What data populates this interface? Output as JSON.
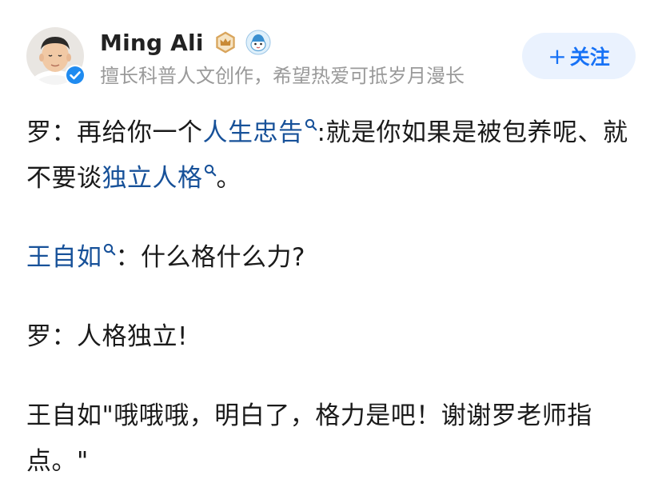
{
  "author": {
    "name": "Ming Ali",
    "bio": "擅长科普人文创作，希望热爱可抵岁月漫长",
    "avatar_icon": "avatar-photo",
    "verified_icon": "verified-check-icon",
    "level_badge_icon": "crown-level-icon",
    "fan_badge_icon": "cartoon-avatar-icon"
  },
  "follow": {
    "plus": "+",
    "label": "关注"
  },
  "colors": {
    "link": "#175199",
    "accent": "#1772f6",
    "follow_bg": "#eaf2fe",
    "bio": "#9a9a9a"
  },
  "paragraphs": [
    {
      "segments": [
        {
          "text": "罗：再给你一个"
        },
        {
          "text": "人生忠告",
          "link": true
        },
        {
          "text": ":就是你如果是被包养呢、就不要谈"
        },
        {
          "text": "独立人格",
          "link": true
        },
        {
          "text": "。"
        }
      ]
    },
    {
      "segments": [
        {
          "text": "王自如",
          "link": true
        },
        {
          "text": "：什么格什么力?"
        }
      ]
    },
    {
      "segments": [
        {
          "text": "罗：人格独立!"
        }
      ]
    },
    {
      "segments": [
        {
          "text": "王自如\"哦哦哦，明白了，格力是吧！谢谢罗老师指点。\""
        }
      ]
    }
  ]
}
